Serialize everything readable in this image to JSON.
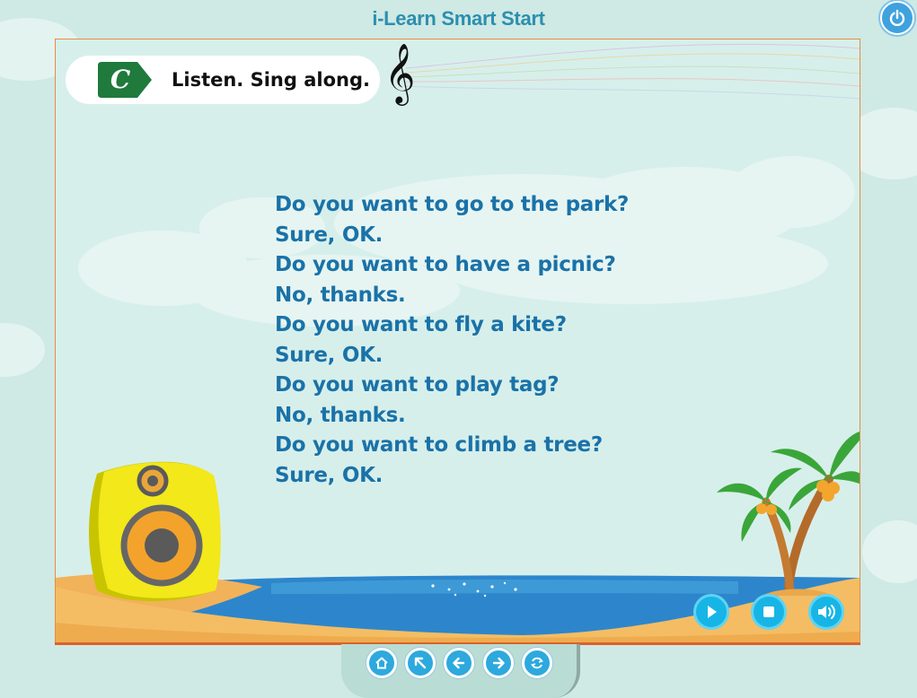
{
  "app": {
    "title": "i-Learn Smart Start"
  },
  "header": {
    "badge_letter": "C",
    "instruction": "Listen. Sing along."
  },
  "lyrics": [
    "Do you want to go to the park?",
    "Sure, OK.",
    "Do you want to have a picnic?",
    "No, thanks.",
    "Do you want to fly a kite?",
    "Sure, OK.",
    "Do you want to play tag?",
    "No, thanks.",
    "Do you want to climb a tree?",
    "Sure, OK."
  ],
  "player_controls": [
    "play-icon",
    "stop-icon",
    "volume-icon"
  ],
  "navigation": [
    "home-icon",
    "back-to-menu-icon",
    "previous-icon",
    "next-icon",
    "replay-icon"
  ],
  "colors": {
    "title": "#2b8fb0",
    "lyrics_text": "#1a72a8",
    "badge": "#1f7a3c",
    "stage_border": "#e98d3f",
    "control_button": "#17b5e6",
    "nav_button": "#2da9de"
  }
}
